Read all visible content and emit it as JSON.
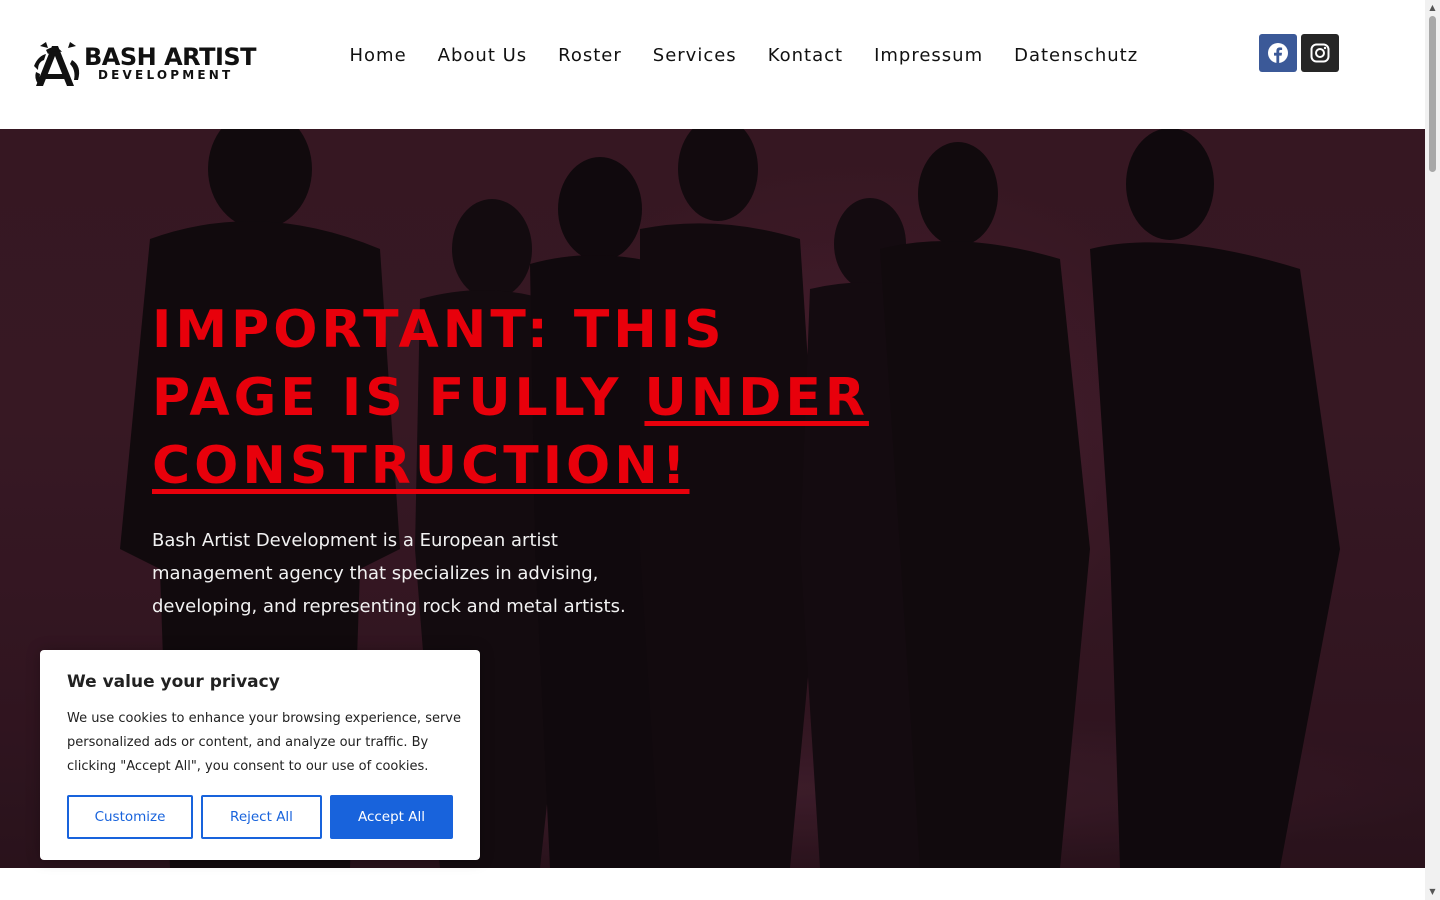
{
  "header": {
    "logo": {
      "title": "BASH ARTIST",
      "subtitle": "DEVELOPMENT"
    },
    "nav": [
      {
        "label": "Home"
      },
      {
        "label": "About Us"
      },
      {
        "label": "Roster"
      },
      {
        "label": "Services"
      },
      {
        "label": "Kontact"
      },
      {
        "label": "Impressum"
      },
      {
        "label": "Datenschutz"
      }
    ],
    "social": [
      {
        "icon": "facebook-icon",
        "color": "#3b5998"
      },
      {
        "icon": "instagram-icon",
        "color": "#262626"
      }
    ]
  },
  "hero": {
    "title_part1": "IMPORTANT: THIS PAGE IS FULLY ",
    "title_underlined": "UNDER CONSTRUCTION!",
    "description": "Bash Artist Development is a European artist management agency that specializes in advising, developing, and representing rock and metal artists.",
    "title_color": "#e8000b"
  },
  "cookie": {
    "title": "We value your privacy",
    "text": "We use cookies to enhance your browsing experience, serve personalized ads or content, and analyze our traffic. By clicking \"Accept All\", you consent to our use of cookies.",
    "customize_label": "Customize",
    "reject_label": "Reject All",
    "accept_label": "Accept All",
    "accent_color": "#1863dc"
  }
}
